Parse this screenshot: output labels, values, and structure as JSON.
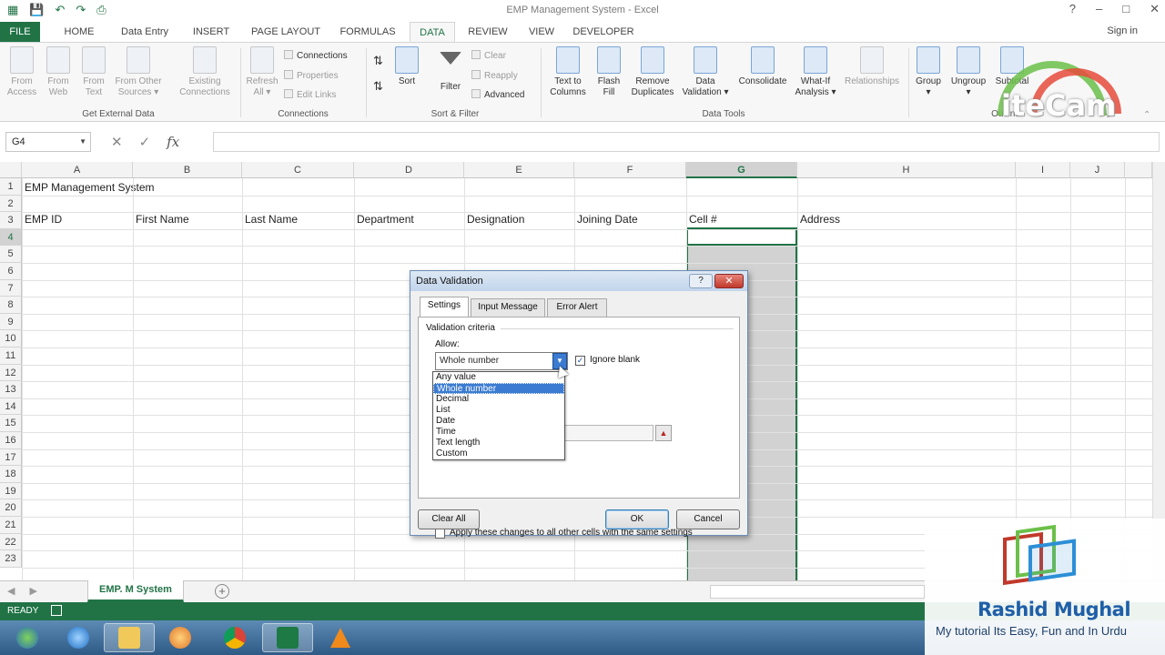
{
  "window": {
    "title": "EMP Management System - Excel",
    "signin": "Sign in",
    "controls": [
      "?",
      "–",
      "□",
      "✕"
    ]
  },
  "ribbon_tabs": [
    "FILE",
    "HOME",
    "Data Entry",
    "INSERT",
    "PAGE LAYOUT",
    "FORMULAS",
    "DATA",
    "REVIEW",
    "VIEW",
    "DEVELOPER"
  ],
  "active_tab": "DATA",
  "ribbon": {
    "get_external": {
      "label": "Get External Data",
      "buttons": [
        "From\nAccess",
        "From\nWeb",
        "From\nText",
        "From Other\nSources ▾",
        "Existing\nConnections"
      ]
    },
    "connections": {
      "label": "Connections",
      "refresh": "Refresh\nAll ▾",
      "items": [
        "Connections",
        "Properties",
        "Edit Links"
      ]
    },
    "sort_filter": {
      "label": "Sort & Filter",
      "sort": "Sort",
      "filter": "Filter",
      "items": [
        "Clear",
        "Reapply",
        "Advanced"
      ]
    },
    "data_tools": {
      "label": "Data Tools",
      "buttons": [
        "Text to\nColumns",
        "Flash\nFill",
        "Remove\nDuplicates",
        "Data\nValidation ▾",
        "Consolidate",
        "What-If\nAnalysis ▾",
        "Relationships"
      ]
    },
    "outline": {
      "label": "Outline",
      "buttons": [
        "Group\n▾",
        "Ungroup\n▾",
        "Subtotal"
      ]
    }
  },
  "watermark": "iteCam",
  "formula_bar": {
    "name_box": "G4",
    "fx": "fx",
    "value": ""
  },
  "columns": [
    "A",
    "B",
    "C",
    "D",
    "E",
    "F",
    "G",
    "H",
    "I",
    "J"
  ],
  "selected_column": "G",
  "rows": [
    "1",
    "2",
    "3",
    "4",
    "5",
    "6",
    "7",
    "8",
    "9",
    "10",
    "11",
    "12",
    "13",
    "14",
    "15",
    "16",
    "17",
    "18",
    "19",
    "20",
    "21",
    "22",
    "23"
  ],
  "cells": {
    "A1": "EMP Management System",
    "A3": "EMP ID",
    "B3": "First Name",
    "C3": "Last Name",
    "D3": "Department",
    "E3": "Designation",
    "F3": "Joining Date",
    "G3": "Cell #",
    "H3": "Address"
  },
  "sheet_tab": "EMP. M System",
  "status": "READY",
  "dialog": {
    "title": "Data Validation",
    "tabs": [
      "Settings",
      "Input Message",
      "Error Alert"
    ],
    "active_tab": "Settings",
    "criteria_label": "Validation criteria",
    "allow_label": "Allow:",
    "allow_value": "Whole number",
    "ignore_blank": "Ignore blank",
    "ignore_blank_checked": true,
    "allow_options": [
      "Any value",
      "Whole number",
      "Decimal",
      "List",
      "Date",
      "Time",
      "Text length",
      "Custom"
    ],
    "allow_selected": "Whole number",
    "apply_label": "Apply these changes to all other cells with the same settings",
    "clear_all": "Clear All",
    "ok": "OK",
    "cancel": "Cancel"
  },
  "branding": {
    "name": "Rashid Mughal",
    "tagline": "My tutorial Its Easy, Fun and In Urdu"
  },
  "colors": {
    "excel_green": "#217346",
    "selection_blue": "#3b7bd1"
  }
}
